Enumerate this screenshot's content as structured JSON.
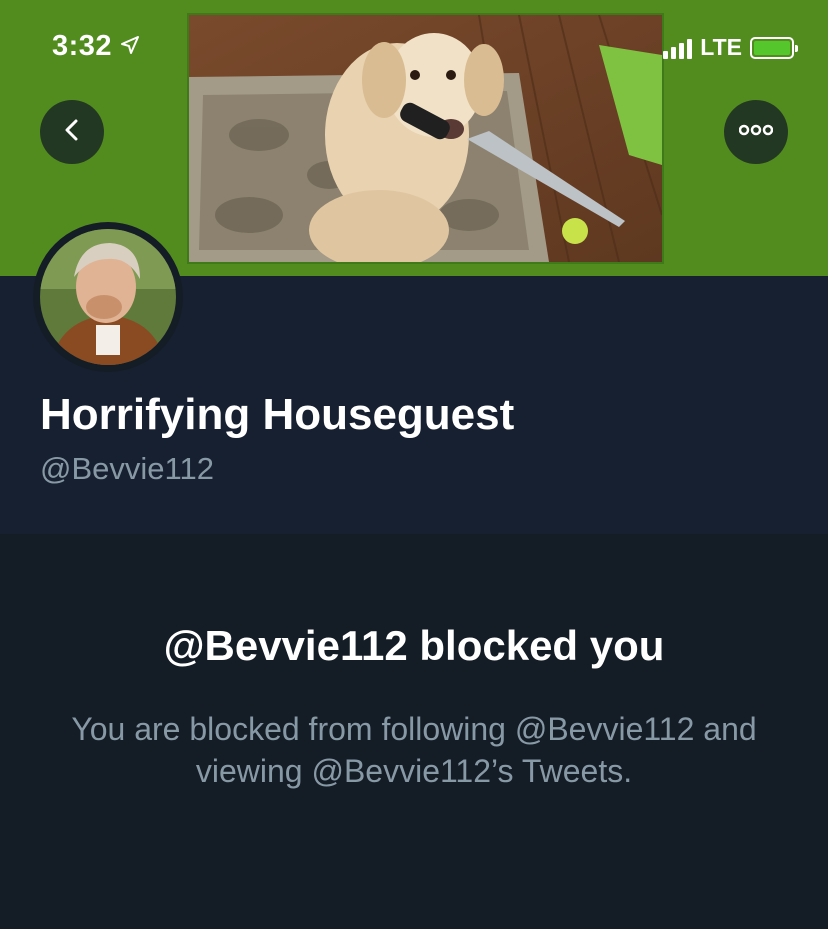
{
  "status_bar": {
    "time": "3:32",
    "carrier": "LTE"
  },
  "header": {
    "back_icon": "chevron-left-icon",
    "more_icon": "more-horizontal-icon",
    "banner_color": "#528c1e"
  },
  "profile": {
    "display_name": "Horrifying Houseguest",
    "handle": "@Bevvie112"
  },
  "blocked_notice": {
    "title": "@Bevvie112 blocked you",
    "description": "You are blocked from following @Bevvie112 and viewing @Bevvie112’s Tweets."
  },
  "colors": {
    "background": "#141c26",
    "panel": "#172030",
    "secondary_text": "#8899a6",
    "battery": "#55c62b"
  }
}
